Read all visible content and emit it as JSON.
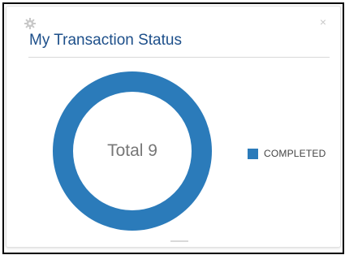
{
  "widget": {
    "title": "My Transaction Status",
    "settings_icon": "gear-icon",
    "close_icon": "close-icon",
    "close_glyph": "×"
  },
  "chart_data": {
    "type": "pie",
    "donut": true,
    "center_label": "Total 9",
    "categories": [
      "COMPLETED"
    ],
    "values": [
      9
    ],
    "colors": [
      "#2b7bba"
    ],
    "legend_position": "right"
  }
}
